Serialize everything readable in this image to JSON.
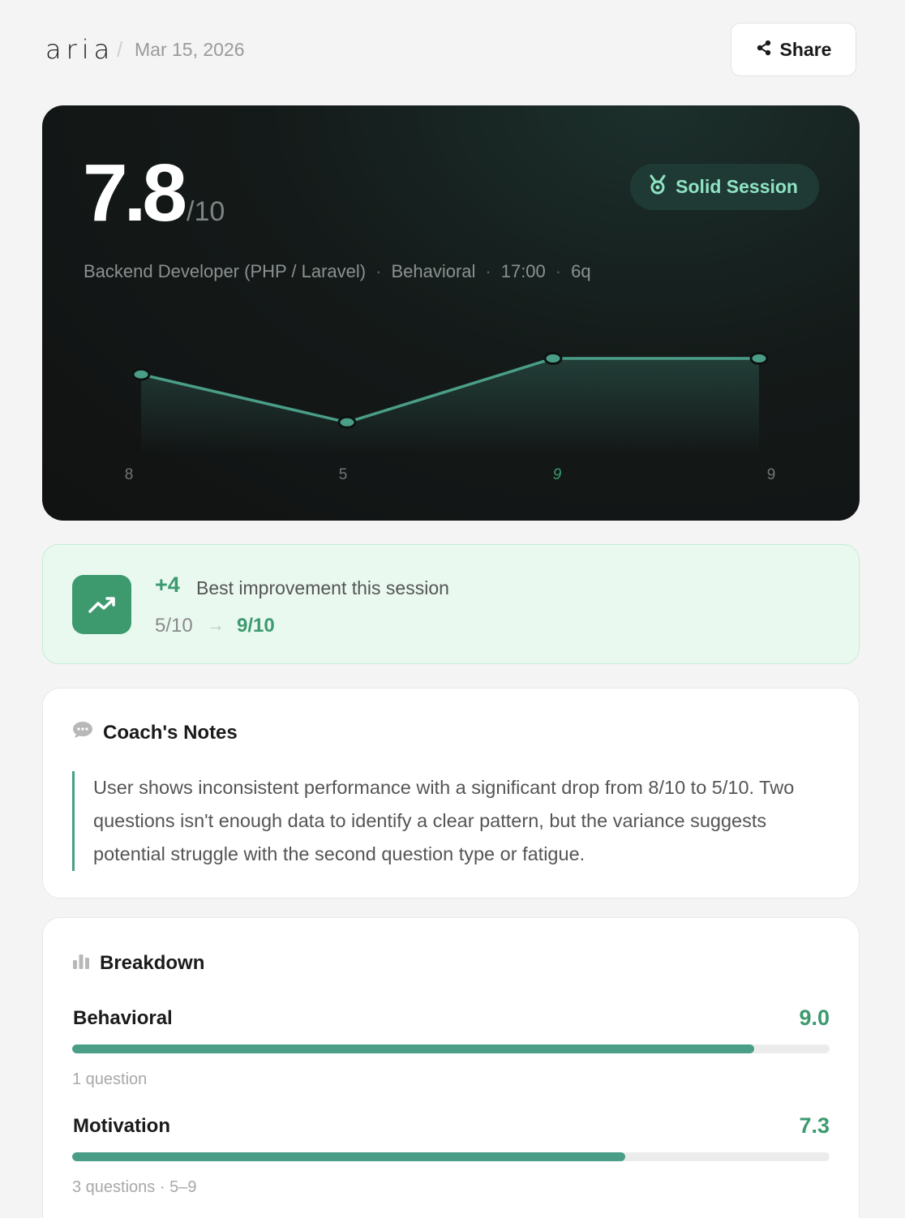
{
  "header": {
    "brand": "aria",
    "separator": "/",
    "date": "Mar 15, 2026",
    "share_label": "Share",
    "share_icon": "share-icon"
  },
  "hero": {
    "score": "7.8",
    "score_max": "/10",
    "badge_label": "Solid Session",
    "badge_icon": "medal-icon",
    "meta": {
      "role": "Backend Developer (PHP / Laravel)",
      "type": "Behavioral",
      "duration": "17:00",
      "questions": "6q",
      "separator": "·"
    },
    "colors": {
      "accent": "#4a9e87",
      "badge_text": "#8fe3c4",
      "highlight_label": "#3d9a6f"
    }
  },
  "chart_data": {
    "type": "line",
    "x": [
      "8",
      "5",
      "9",
      "9"
    ],
    "values": [
      8,
      5,
      9,
      9
    ],
    "highlight_index": 2,
    "ylim": [
      0,
      10
    ],
    "grid": false
  },
  "improvement": {
    "icon": "trending-up-icon",
    "delta": "+4",
    "label": "Best improvement this session",
    "from": "5/10",
    "arrow": "→",
    "to": "9/10"
  },
  "notes": {
    "icon": "speech-bubble-icon",
    "title": "Coach's Notes",
    "text": "User shows inconsistent performance with a significant drop from 8/10 to 5/10. Two questions isn't enough data to identify a clear pattern, but the variance suggests potential struggle with the second question type or fatigue."
  },
  "breakdown": {
    "icon": "bar-chart-icon",
    "title": "Breakdown",
    "rows": [
      {
        "name": "Behavioral",
        "score": "9.0",
        "score_value": 9.0,
        "sub": "1 question"
      },
      {
        "name": "Motivation",
        "score": "7.3",
        "score_value": 7.3,
        "sub": "3 questions · 5–9"
      }
    ]
  }
}
